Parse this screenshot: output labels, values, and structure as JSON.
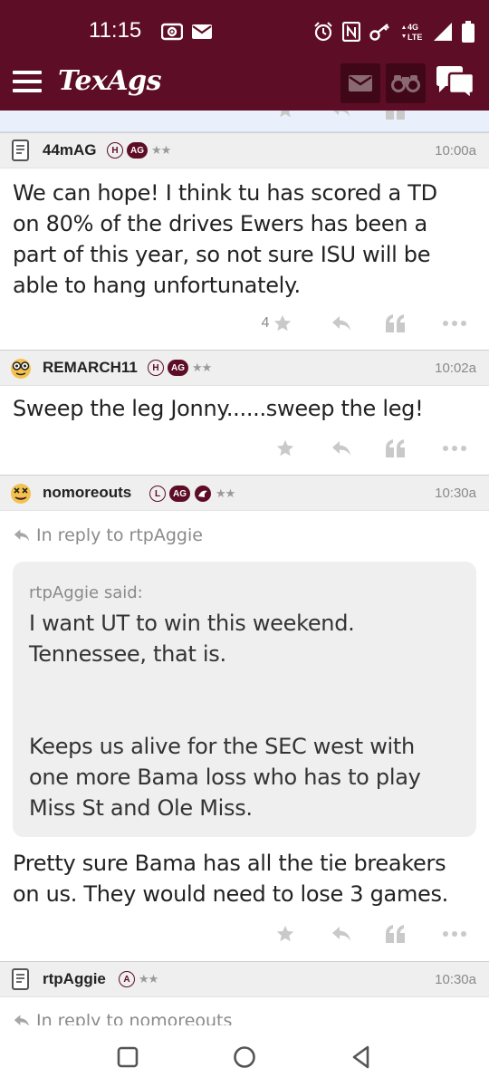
{
  "status_bar": {
    "time": "11:15",
    "network": "4G LTE"
  },
  "app": {
    "logo": "TexAgs",
    "brand_color": "#5d0d25"
  },
  "posts": [
    {
      "username": "44mAG",
      "avatar": "document-icon",
      "badges": [
        "H",
        "AG"
      ],
      "stars": "★★",
      "time": "10:00a",
      "lines": [
        "We can hope! I think tu has scored a TD",
        "on 80% of the drives Ewers has been a",
        "part of this year, so not sure ISU will be",
        "able to hang unfortunately."
      ],
      "likes": "4"
    },
    {
      "username": "REMARCH11",
      "avatar": "nerd-face-icon",
      "badges": [
        "H",
        "AG"
      ],
      "stars": "★★",
      "time": "10:02a",
      "lines": [
        "Sweep the leg Jonny......sweep the leg!"
      ]
    },
    {
      "username": "nomoreouts",
      "avatar": "dizzy-face-icon",
      "badges": [
        "L",
        "AG"
      ],
      "stars": "★★",
      "time": "10:30a",
      "reply_to": "In reply to rtpAggie",
      "quote": {
        "attribution": "rtpAggie said:",
        "para1": [
          "I want UT to win this weekend.",
          "Tennessee, that is."
        ],
        "para2": [
          "Keeps us alive for the SEC west with",
          "one more Bama loss who has to play",
          "Miss St and Ole Miss."
        ]
      },
      "lines": [
        "Pretty sure Bama has all the tie breakers",
        "on us. They would need to lose 3 games."
      ]
    },
    {
      "username": "rtpAggie",
      "avatar": "document-icon",
      "badges": [
        "A"
      ],
      "stars": "★★",
      "time": "10:30a",
      "reply_to": "In reply to nomoreouts"
    }
  ]
}
